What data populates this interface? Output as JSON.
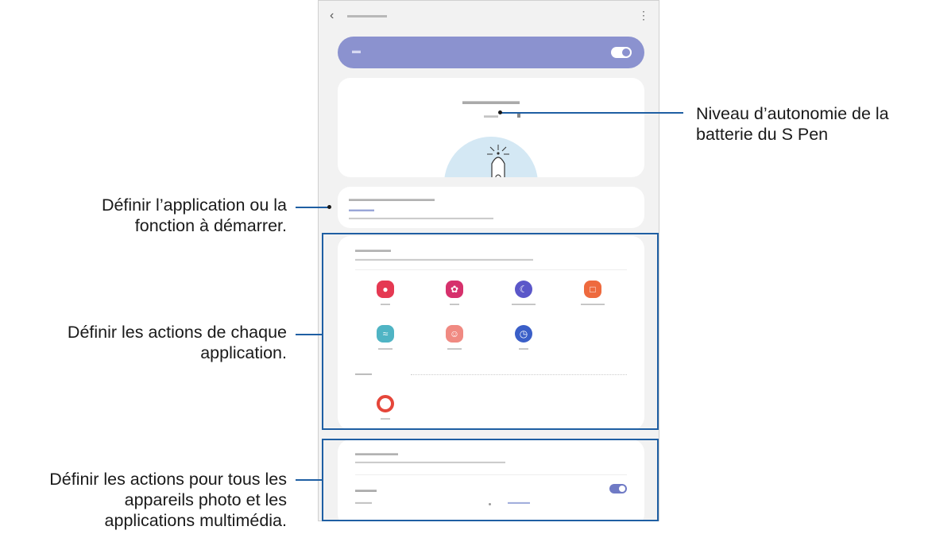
{
  "callouts": {
    "battery": [
      "Niveau d’autonomie de la",
      "batterie du S Pen"
    ],
    "hold": [
      "Définir l’application ou la",
      "fonction à démarrer."
    ],
    "app_actions": [
      "Définir les actions de chaque",
      "application."
    ],
    "multimedia": [
      "Définir les actions pour tous les",
      "appareils photo et les",
      "applications multimédia."
    ]
  },
  "colors": {
    "callout_line": "#1f5fa3",
    "accent": "#8b92cf",
    "toggle_on": "#6f7ac5"
  },
  "icons": {
    "back": "chevron-left-icon",
    "more": "more-options-icon",
    "pen": "s-pen-icon"
  },
  "phone": {
    "toggle_on": true,
    "camera_toggle_on": true
  }
}
